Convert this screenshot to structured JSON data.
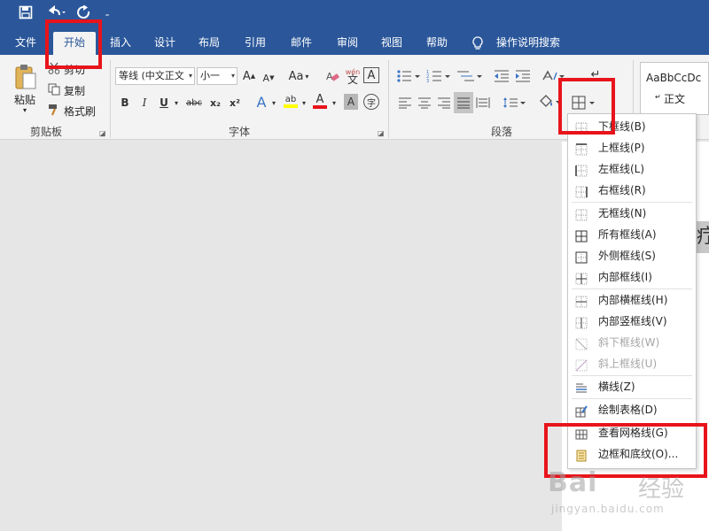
{
  "quick_access": {
    "customize": "₌"
  },
  "tabs": [
    {
      "label": "文件"
    },
    {
      "label": "开始"
    },
    {
      "label": "插入"
    },
    {
      "label": "设计"
    },
    {
      "label": "布局"
    },
    {
      "label": "引用"
    },
    {
      "label": "邮件"
    },
    {
      "label": "审阅"
    },
    {
      "label": "视图"
    },
    {
      "label": "帮助"
    }
  ],
  "tell_me": "操作说明搜索",
  "ribbon": {
    "clipboard": {
      "paste": "粘贴",
      "cut": "剪切",
      "copy": "复制",
      "format_painter": "格式刷",
      "label": "剪贴板"
    },
    "font": {
      "font_name": "等线 (中文正文",
      "font_size": "小一",
      "label": "字体",
      "case_button": "Aa",
      "phonetic_top": "wén",
      "phonetic_bottom": "文",
      "border_char": "A",
      "bold": "B",
      "italic": "I",
      "underline": "U",
      "strike": "abc",
      "subscript": "x₂",
      "superscript": "x²",
      "effects": "A",
      "highlight": "ab",
      "font_color": "A",
      "shading_char": "A",
      "enclose_char": "字",
      "grow": "A",
      "shrink": "A"
    },
    "paragraph": {
      "label": "段落"
    },
    "styles": {
      "preview": "AaBbCcDc",
      "normal": "正文"
    }
  },
  "border_menu": {
    "items": [
      {
        "label": "下框线(B)",
        "icon": "bottom-border-icon",
        "disabled": false
      },
      {
        "label": "上框线(P)",
        "icon": "top-border-icon",
        "disabled": false
      },
      {
        "label": "左框线(L)",
        "icon": "left-border-icon",
        "disabled": false
      },
      {
        "label": "右框线(R)",
        "icon": "right-border-icon",
        "disabled": false
      },
      {
        "label": "无框线(N)",
        "icon": "no-border-icon",
        "disabled": false
      },
      {
        "label": "所有框线(A)",
        "icon": "all-borders-icon",
        "disabled": false
      },
      {
        "label": "外侧框线(S)",
        "icon": "outside-borders-icon",
        "disabled": false
      },
      {
        "label": "内部框线(I)",
        "icon": "inside-borders-icon",
        "disabled": false
      },
      {
        "label": "内部横框线(H)",
        "icon": "inside-horizontal-border-icon",
        "disabled": false
      },
      {
        "label": "内部竖框线(V)",
        "icon": "inside-vertical-border-icon",
        "disabled": false
      },
      {
        "label": "斜下框线(W)",
        "icon": "diagonal-down-border-icon",
        "disabled": true
      },
      {
        "label": "斜上框线(U)",
        "icon": "diagonal-up-border-icon",
        "disabled": true
      },
      {
        "label": "横线(Z)",
        "icon": "horizontal-line-icon",
        "disabled": false
      },
      {
        "label": "绘制表格(D)",
        "icon": "draw-table-icon",
        "disabled": false
      },
      {
        "label": "查看网格线(G)",
        "icon": "view-gridlines-icon",
        "disabled": false
      },
      {
        "label": "边框和底纹(O)...",
        "icon": "borders-shading-icon",
        "disabled": false
      }
    ]
  },
  "document": {
    "fragment": "疗"
  },
  "watermark": {
    "logo": "Bai",
    "text": "经验",
    "url": "jingyan.baidu.com"
  },
  "colors": {
    "brand": "#2b579a",
    "highlight_box": "#e8141b",
    "ribbon_bg": "#f3f3f3",
    "canvas_bg": "#e6e6e6"
  }
}
